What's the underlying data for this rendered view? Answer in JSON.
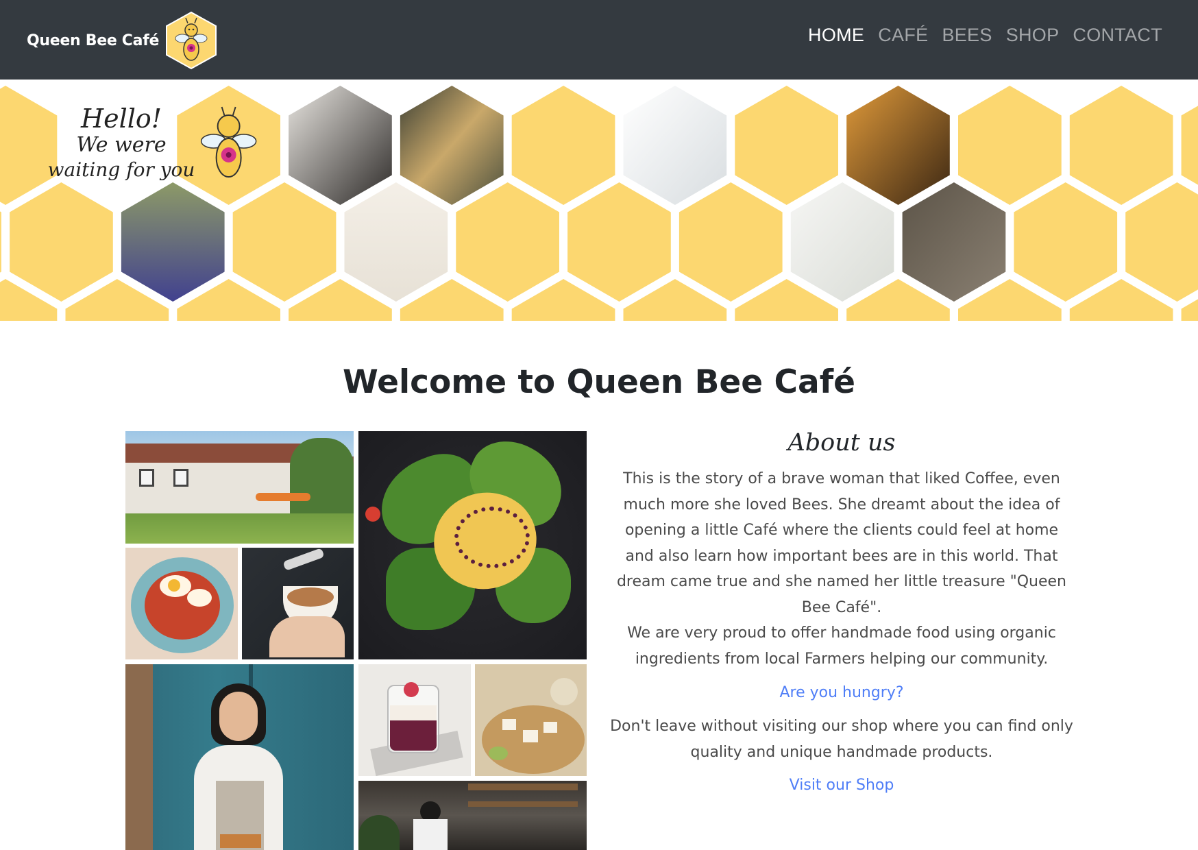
{
  "brand": {
    "name": "Queen Bee Café",
    "logo_icon": "bee-logo-icon"
  },
  "nav": {
    "items": [
      {
        "label": "HOME",
        "active": true
      },
      {
        "label": "CAFÉ",
        "active": false
      },
      {
        "label": "BEES",
        "active": false
      },
      {
        "label": "SHOP",
        "active": false
      },
      {
        "label": "CONTACT",
        "active": false
      }
    ]
  },
  "hero": {
    "greeting_line1": "Hello!",
    "greeting_line2": "We were",
    "greeting_line3": "waiting for you",
    "background_color": "#fcd770"
  },
  "main": {
    "heading": "Welcome to Queen Bee Café",
    "about": {
      "title": "About us",
      "paragraph1": "This is the story of a brave woman that liked Coffee, even much more she loved Bees. She dreamt about the idea of opening a little Café where the clients could feel at home and also learn how important bees are in this world. That dream came true and she named her little treasure \"Queen Bee Café\".",
      "paragraph1b": "We are very proud to offer handmade food using organic ingredients from local Farmers helping our community.",
      "link_hungry": "Are you hungry?",
      "paragraph2": "Don't leave without visiting our shop where you can find only quality and unique handmade products.",
      "link_shop": "Visit our Shop"
    }
  },
  "colors": {
    "navbar": "#343a40",
    "link": "#4f7ef7",
    "honeycomb": "#fcd770"
  }
}
